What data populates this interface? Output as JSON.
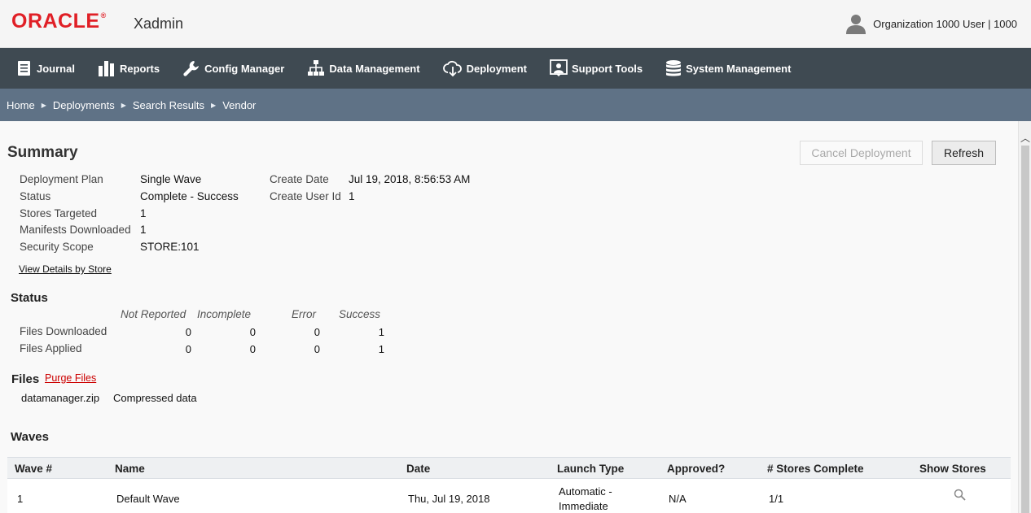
{
  "brand": {
    "logo": "ORACLE",
    "app": "Xadmin"
  },
  "user": {
    "label": "Organization 1000 User | 1000"
  },
  "nav": [
    {
      "label": "Journal",
      "icon": "journal-icon"
    },
    {
      "label": "Reports",
      "icon": "reports-icon"
    },
    {
      "label": "Config Manager",
      "icon": "wrench-icon"
    },
    {
      "label": "Data Management",
      "icon": "hierarchy-icon"
    },
    {
      "label": "Deployment",
      "icon": "cloud-download-icon"
    },
    {
      "label": "Support Tools",
      "icon": "support-icon"
    },
    {
      "label": "System Management",
      "icon": "database-icon"
    }
  ],
  "breadcrumb": [
    "Home",
    "Deployments",
    "Search Results",
    "Vendor"
  ],
  "summary": {
    "title": "Summary",
    "cancel_label": "Cancel Deployment",
    "refresh_label": "Refresh",
    "fields": {
      "plan_label": "Deployment Plan",
      "plan_value": "Single Wave",
      "status_label": "Status",
      "status_value": "Complete - Success",
      "stores_label": "Stores Targeted",
      "stores_value": "1",
      "manifests_label": "Manifests Downloaded",
      "manifests_value": "1",
      "scope_label": "Security Scope",
      "scope_value": "STORE:101",
      "create_date_label": "Create Date",
      "create_date_value": "Jul 19, 2018, 8:56:53 AM",
      "create_user_label": "Create User Id",
      "create_user_value": "1"
    },
    "details_link": "View Details by Store"
  },
  "status": {
    "title": "Status",
    "headers": [
      "Not Reported",
      "Incomplete",
      "Error",
      "Success"
    ],
    "rows": [
      {
        "label": "Files Downloaded",
        "values": [
          "0",
          "0",
          "0",
          "1"
        ]
      },
      {
        "label": "Files Applied",
        "values": [
          "0",
          "0",
          "0",
          "1"
        ]
      }
    ]
  },
  "files": {
    "title": "Files",
    "purge_label": "Purge Files",
    "items": [
      {
        "name": "datamanager.zip",
        "desc": "Compressed data"
      }
    ]
  },
  "waves": {
    "title": "Waves",
    "headers": [
      "Wave #",
      "Name",
      "Date",
      "Launch Type",
      "Approved?",
      "# Stores Complete",
      "Show Stores"
    ],
    "rows": [
      {
        "wave": "1",
        "name": "Default Wave",
        "date": "Thu, Jul 19, 2018",
        "launch_line1": "Automatic -",
        "launch_line2": "Immediate",
        "approved": "N/A",
        "stores_complete": "1/1"
      }
    ]
  }
}
